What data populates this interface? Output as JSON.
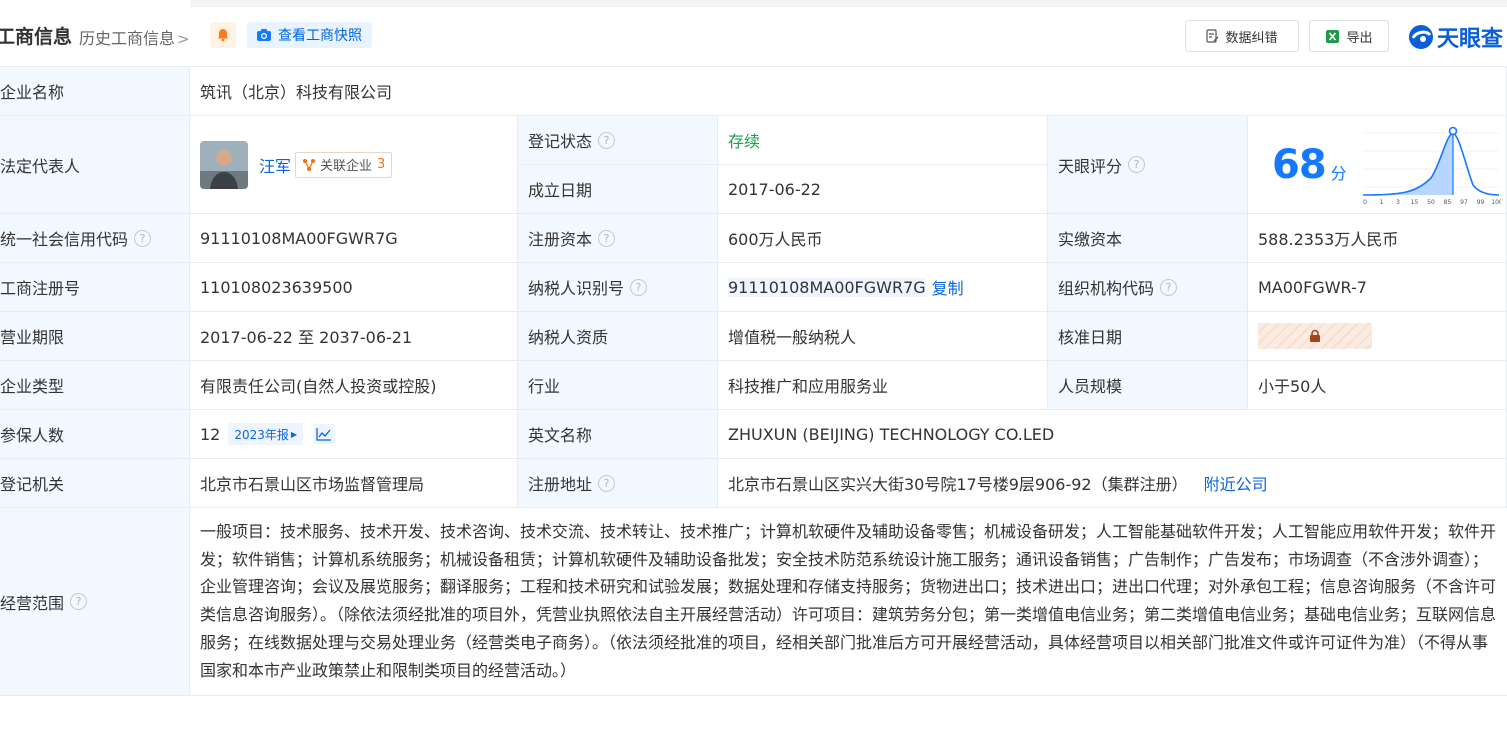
{
  "header": {
    "title": "工商信息",
    "history": "历史工商信息",
    "snapshot": "查看工商快照",
    "error_btn": "数据纠错",
    "export_btn": "导出",
    "logo": "天眼查"
  },
  "rows": {
    "company_name": {
      "label": "企业名称",
      "value": "筑讯（北京）科技有限公司"
    },
    "legal_rep": {
      "label": "法定代表人",
      "name": "汪军",
      "related_label": "关联企业",
      "related_count": "3"
    },
    "reg_status": {
      "label": "登记状态",
      "value": "存续"
    },
    "est_date": {
      "label": "成立日期",
      "value": "2017-06-22"
    },
    "score": {
      "label": "天眼评分",
      "value": "68",
      "unit": "分",
      "axis": [
        "0",
        "1",
        "3",
        "15",
        "50",
        "85",
        "97",
        "99",
        "100"
      ]
    },
    "credit_code": {
      "label": "统一社会信用代码",
      "value": "91110108MA00FGWR7G"
    },
    "reg_capital": {
      "label": "注册资本",
      "value": "600万人民币"
    },
    "paid_capital": {
      "label": "实缴资本",
      "value": "588.2353万人民币"
    },
    "reg_no": {
      "label": "工商注册号",
      "value": "110108023639500"
    },
    "tax_id": {
      "label": "纳税人识别号",
      "value": "91110108MA00FGWR7G",
      "copy": "复制"
    },
    "org_code": {
      "label": "组织机构代码",
      "value": "MA00FGWR-7"
    },
    "term": {
      "label": "营业期限",
      "value": "2017-06-22 至 2037-06-21"
    },
    "tax_quality": {
      "label": "纳税人资质",
      "value": "增值税一般纳税人"
    },
    "approve_date": {
      "label": "核准日期"
    },
    "company_type": {
      "label": "企业类型",
      "value": "有限责任公司(自然人投资或控股)"
    },
    "industry": {
      "label": "行业",
      "value": "科技推广和应用服务业"
    },
    "staff_size": {
      "label": "人员规模",
      "value": "小于50人"
    },
    "insured": {
      "label": "参保人数",
      "value": "12",
      "report": "2023年报"
    },
    "english_name": {
      "label": "英文名称",
      "value": "ZHUXUN (BEIJING) TECHNOLOGY CO.LED"
    },
    "authority": {
      "label": "登记机关",
      "value": "北京市石景山区市场监督管理局"
    },
    "address": {
      "label": "注册地址",
      "value": "北京市石景山区实兴大街30号院17号楼9层906-92（集群注册）",
      "nearby": "附近公司"
    },
    "scope": {
      "label": "经营范围",
      "value": "一般项目：技术服务、技术开发、技术咨询、技术交流、技术转让、技术推广；计算机软硬件及辅助设备零售；机械设备研发；人工智能基础软件开发；人工智能应用软件开发；软件开发；软件销售；计算机系统服务；机械设备租赁；计算机软硬件及辅助设备批发；安全技术防范系统设计施工服务；通讯设备销售；广告制作；广告发布；市场调查（不含涉外调查）；企业管理咨询；会议及展览服务；翻译服务；工程和技术研究和试验发展；数据处理和存储支持服务；货物进出口；技术进出口；进出口代理；对外承包工程；信息咨询服务（不含许可类信息咨询服务）。（除依法须经批准的项目外，凭营业执照依法自主开展经营活动）许可项目：建筑劳务分包；第一类增值电信业务；第二类增值电信业务；基础电信业务；互联网信息服务；在线数据处理与交易处理业务（经营类电子商务）。（依法须经批准的项目，经相关部门批准后方可开展经营活动，具体经营项目以相关部门批准文件或许可证件为准）（不得从事国家和本市产业政策禁止和限制类项目的经营活动。）"
    }
  },
  "colors": {
    "accent": "#0a66e0",
    "label_bg": "#f2f8ff",
    "status_green": "#17a34a",
    "related_orange": "#f07015"
  }
}
